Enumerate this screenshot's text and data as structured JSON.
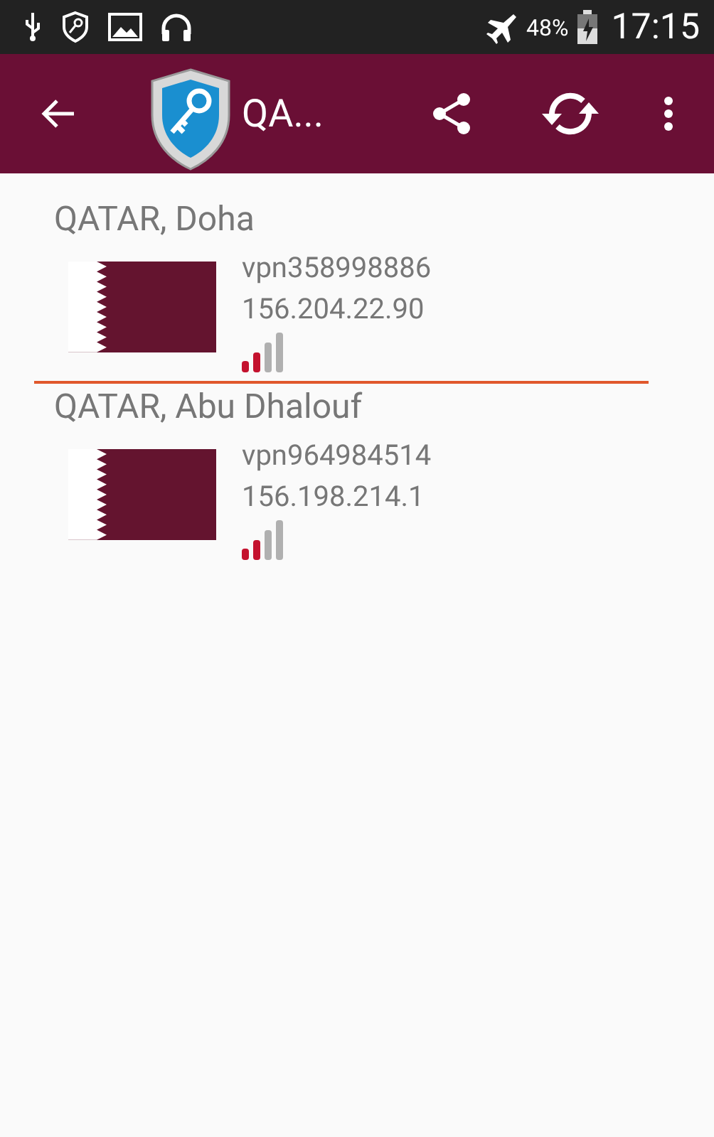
{
  "status_bar": {
    "battery": "48%",
    "time": "17:15"
  },
  "toolbar": {
    "title": "QA..."
  },
  "servers": [
    {
      "location": "QATAR, Doha",
      "name": "vpn358998886",
      "ip": "156.204.22.90"
    },
    {
      "location": "QATAR, Abu Dhalouf",
      "name": "vpn964984514",
      "ip": "156.198.214.1"
    }
  ]
}
